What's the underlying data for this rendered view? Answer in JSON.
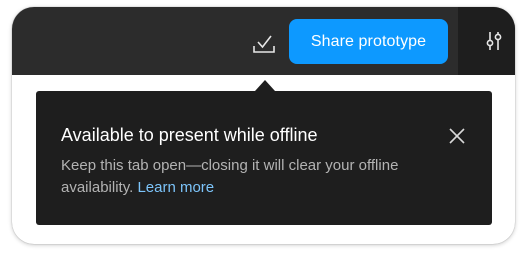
{
  "toolbar": {
    "share_label": "Share prototype"
  },
  "popover": {
    "title": "Available to present while offline",
    "body": "Keep this tab open—closing it will clear your offline availability.",
    "link": "Learn more"
  },
  "icons": {
    "download": "download-check-icon",
    "settings": "sliders-icon",
    "close": "close-icon"
  },
  "colors": {
    "toolbar_bg": "#2c2c2c",
    "popover_bg": "#1e1e1e",
    "accent": "#0d99ff",
    "link": "#7cc4fa"
  }
}
